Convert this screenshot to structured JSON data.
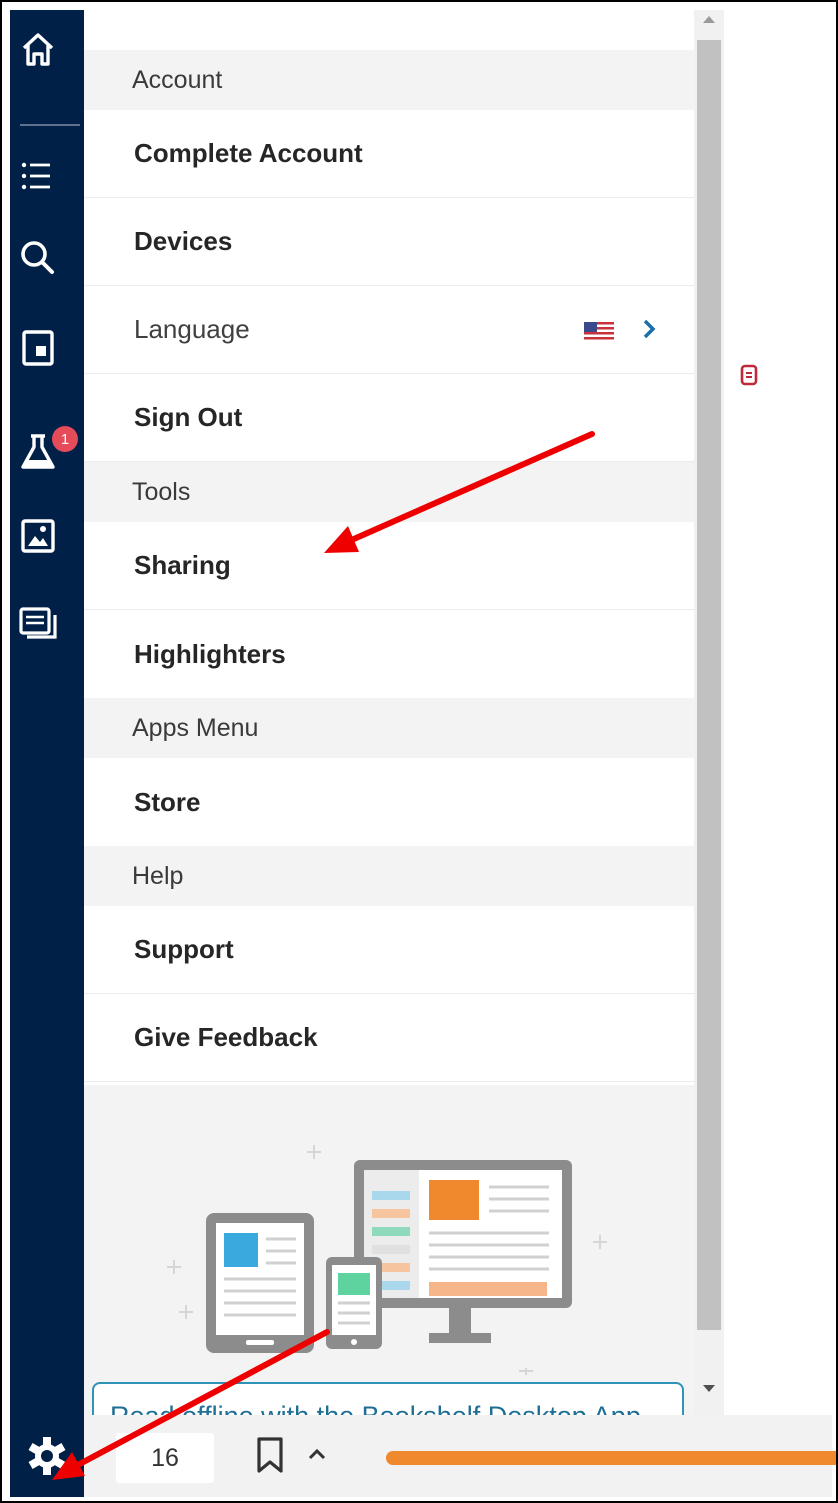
{
  "rail": {
    "items": [
      {
        "name": "home-icon"
      },
      {
        "name": "toc-list-icon"
      },
      {
        "name": "search-icon"
      },
      {
        "name": "pages-icon"
      },
      {
        "name": "flask-icon",
        "badge": "1"
      },
      {
        "name": "image-icon"
      },
      {
        "name": "notes-icon"
      }
    ]
  },
  "menu": {
    "account": {
      "heading": "Account",
      "complete_account": "Complete Account",
      "devices": "Devices",
      "language": "Language",
      "sign_out": "Sign Out"
    },
    "tools": {
      "heading": "Tools",
      "sharing": "Sharing",
      "highlighters": "Highlighters"
    },
    "apps": {
      "heading": "Apps Menu",
      "store": "Store"
    },
    "help": {
      "heading": "Help",
      "support": "Support",
      "give_feedback": "Give Feedback"
    }
  },
  "promo": {
    "link_text": "Read offline with the Bookshelf Desktop App"
  },
  "toolbar": {
    "page_number": "16",
    "progress": 1.0
  },
  "colors": {
    "rail": "#002047",
    "accent_orange": "#f0892e",
    "link_blue": "#1e6e96",
    "badge_red": "#e64b5a",
    "arrow_red": "#ee0000"
  }
}
